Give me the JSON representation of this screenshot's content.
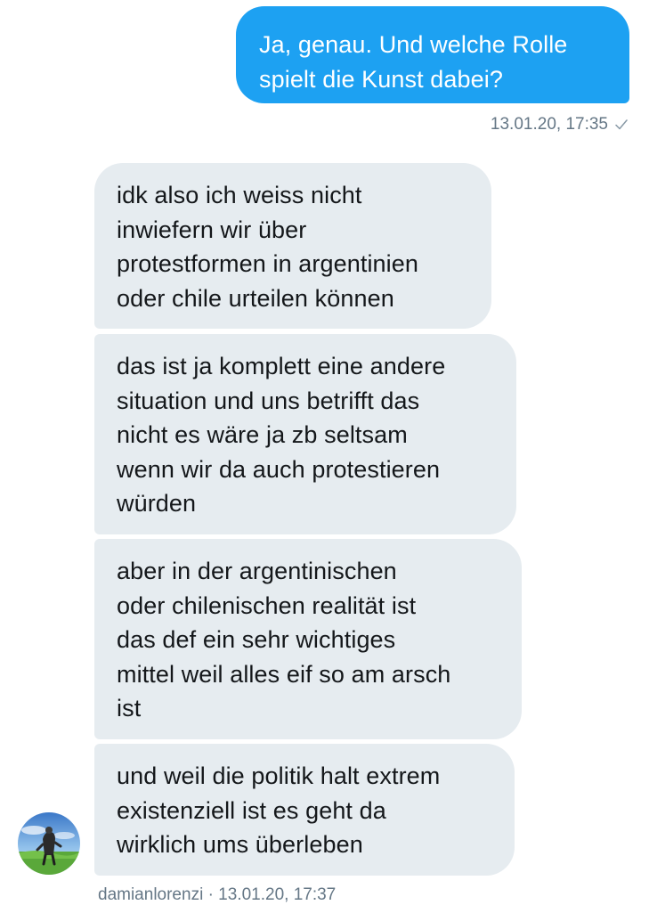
{
  "conversation": {
    "sent_message": {
      "text": "Ja, genau. Und welche Rolle\nspielt die Kunst dabei?",
      "timestamp": "13.01.20, 17:35",
      "status_icon": "sent-check-icon"
    },
    "received_messages": [
      {
        "text": "idk also ich weiss nicht\ninwiefern wir über\nprotestformen in argentinien\noder chile urteilen können"
      },
      {
        "text": "das ist ja komplett eine andere\nsituation und uns betrifft das\nnicht es wäre ja zb seltsam\nwenn wir da auch protestieren\nwürden"
      },
      {
        "text": "aber in der argentinischen\noder chilenischen realität ist\ndas def ein sehr wichtiges\nmittel weil alles eif so am arsch\nist"
      },
      {
        "text": "und weil die politik halt extrem\nexistenziell ist es geht da\nwirklich ums überleben"
      }
    ],
    "received_footer": "damianlorenzi · 13.01.20, 17:37",
    "colors": {
      "sent_bubble": "#1da1f2",
      "received_bubble": "#e6ecf0",
      "received_text": "#14171a",
      "meta_text": "#657786"
    }
  }
}
